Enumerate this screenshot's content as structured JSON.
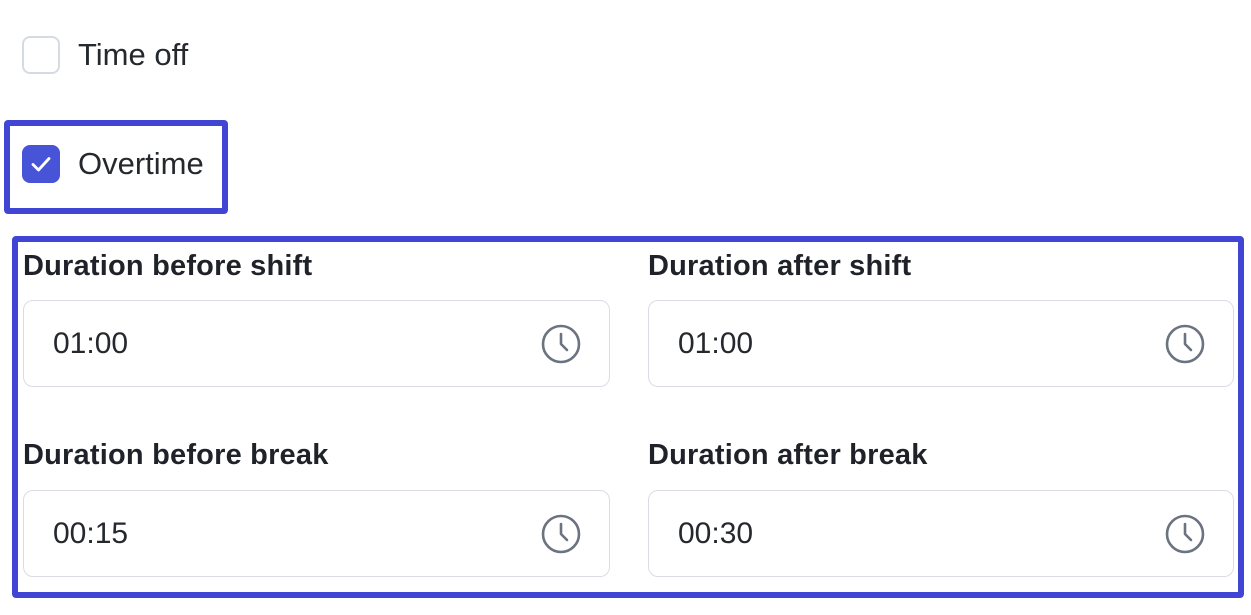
{
  "checkboxes": {
    "time_off": {
      "label": "Time off",
      "checked": false
    },
    "overtime": {
      "label": "Overtime",
      "checked": true
    }
  },
  "durations": {
    "before_shift": {
      "label": "Duration before shift",
      "value": "01:00",
      "icon": "clock-icon"
    },
    "after_shift": {
      "label": "Duration after shift",
      "value": "01:00",
      "icon": "clock-icon"
    },
    "before_break": {
      "label": "Duration before break",
      "value": "00:15",
      "icon": "clock-icon"
    },
    "after_break": {
      "label": "Duration after break",
      "value": "00:30",
      "icon": "clock-icon"
    }
  },
  "colors": {
    "accent": "#4854d8",
    "highlight": "#4145d3",
    "input_border": "#d9dde3",
    "icon": "#6b7280"
  }
}
